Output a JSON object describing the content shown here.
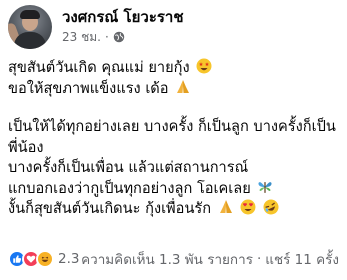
{
  "post": {
    "author": "วงศกรณ์ โยวะราช",
    "timestamp": "23 ชม.",
    "separator": "·",
    "audience_icon": "globe-icon",
    "lines": [
      "สุขสันต์วันเกิด คุณแม่ ยายกุ้ง",
      "ขอให้สุขภาพแข็งแรง เด้อ",
      "เป็นให้ได้ทุกอย่างเลย บางครั้ง ก็เป็นลูก บางครั้งก็เป็น",
      "พี่น้อง",
      "บางครั้งก็เป็นเพื่อน แล้วแต่สถานการณ์",
      "แกบอกเองว่ากูเป็นทุกอย่างลูก โอเคเลย",
      "งั้นก็สุขสันต์วันเกิดนะ กุ้งเพื่อนรัก"
    ],
    "emojis": {
      "line1": [
        "star-struck-icon"
      ],
      "line2": [
        "folded-hands-icon"
      ],
      "line6": [
        "butterfly-icon"
      ],
      "line7": [
        "folded-hands-icon",
        "heart-eyes-icon",
        "rofl-icon"
      ]
    }
  },
  "footer": {
    "reactions": [
      "like-icon",
      "love-icon",
      "haha-icon"
    ],
    "reaction_count": "2.3",
    "comments": "ความคิดเห็น 1.3 พัน รายการ",
    "separator": "·",
    "shares": "แชร์ 11 ครั้ง"
  },
  "colors": {
    "like": "#1877f2",
    "love": "#f33e58",
    "haha": "#f7b125",
    "secondary_text": "#65676b"
  }
}
